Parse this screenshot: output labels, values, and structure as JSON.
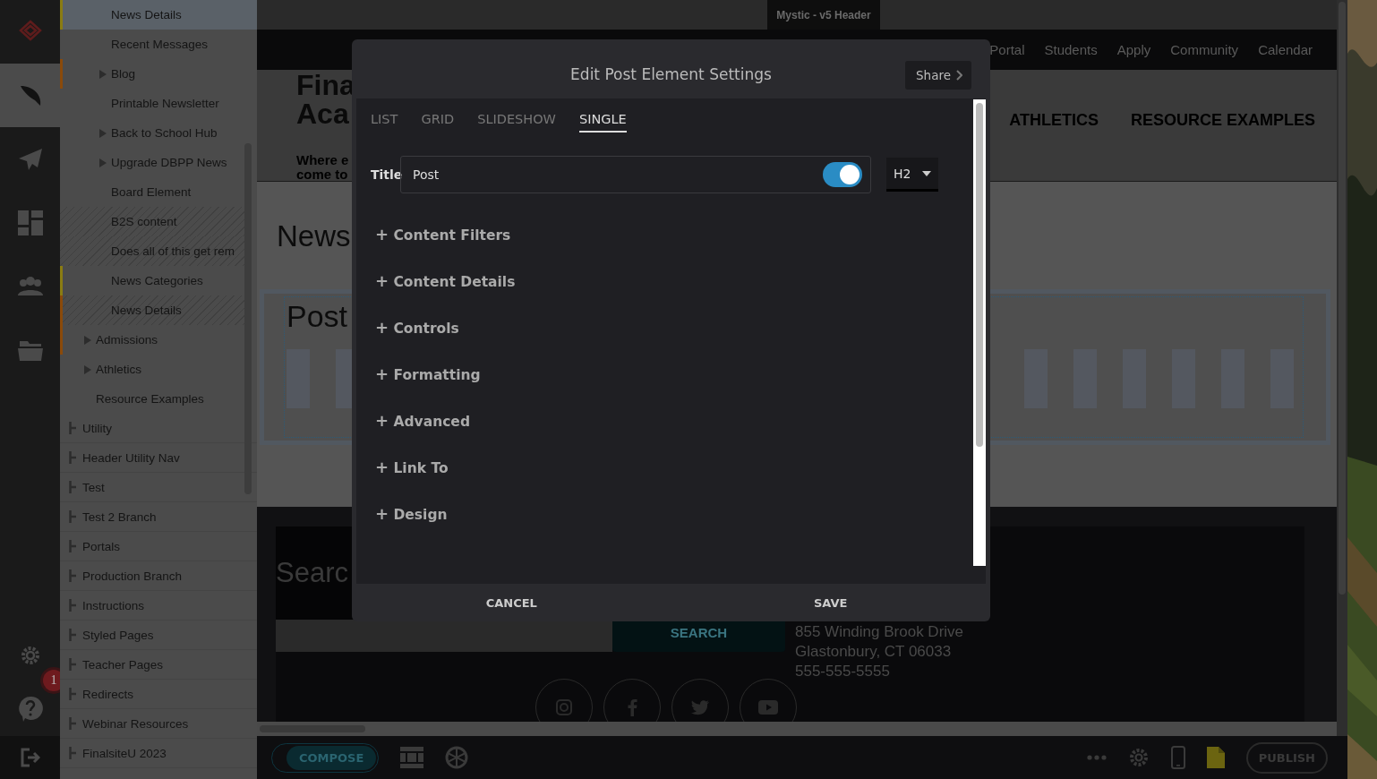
{
  "rail": {
    "items": [
      {
        "kind": "logo",
        "selected": false
      },
      {
        "kind": "feather",
        "selected": true
      },
      {
        "kind": "plane",
        "selected": false
      },
      {
        "kind": "dashboard",
        "selected": false
      },
      {
        "kind": "people",
        "selected": false
      },
      {
        "kind": "folder",
        "selected": false
      }
    ],
    "badge": "1"
  },
  "sidebar": {
    "tree": [
      {
        "children": [
          {
            "children": [
              {
                "label": "News Details",
                "kind": "leaf",
                "selected": true,
                "hidden": false,
                "color": "#8a7c12"
              },
              {
                "label": "Recent Messages",
                "kind": "leaf",
                "selected": false,
                "hidden": false
              },
              {
                "label": "Blog",
                "kind": "folder",
                "selected": false,
                "hidden": false,
                "color": "#8a4a0a"
              },
              {
                "label": "Printable Newsletter",
                "kind": "leaf",
                "selected": false,
                "hidden": false
              },
              {
                "label": "Back to School Hub",
                "kind": "folder",
                "selected": false,
                "hidden": false
              },
              {
                "label": "Upgrade DBPP News",
                "kind": "folder",
                "selected": false,
                "hidden": false
              },
              {
                "label": "Board Element",
                "kind": "leaf",
                "selected": false,
                "hidden": false
              },
              {
                "label": "B2S content",
                "kind": "leaf",
                "selected": false,
                "hidden": true
              },
              {
                "label": "Does all of this get rem",
                "kind": "leaf",
                "selected": false,
                "hidden": true
              },
              {
                "label": "News Categories",
                "kind": "leaf",
                "selected": false,
                "hidden": false,
                "color": "#8a7c12"
              },
              {
                "label": "News Details",
                "kind": "leaf",
                "selected": false,
                "hidden": true,
                "color": "#8a4a0a"
              }
            ]
          },
          {
            "label": "Admissions",
            "kind": "folder",
            "selected": false,
            "hidden": false,
            "color": "#8a4a0a"
          },
          {
            "label": "Athletics",
            "kind": "folder",
            "selected": false,
            "hidden": false
          },
          {
            "label": "Resource Examples",
            "kind": "leaf",
            "selected": false,
            "hidden": false
          }
        ]
      },
      {
        "label": "Utility",
        "kind": "branch",
        "selected": false,
        "hidden": false
      },
      {
        "label": "Header Utility Nav",
        "kind": "branch",
        "selected": false,
        "hidden": false
      },
      {
        "label": "Test",
        "kind": "branch",
        "selected": false,
        "hidden": false
      },
      {
        "label": "Test 2 Branch",
        "kind": "branch",
        "selected": false,
        "hidden": false
      },
      {
        "label": "Portals",
        "kind": "branch",
        "selected": false,
        "hidden": false
      },
      {
        "label": "Production Branch",
        "kind": "branch",
        "selected": false,
        "hidden": false
      },
      {
        "label": "Instructions",
        "kind": "branch",
        "selected": false,
        "hidden": false
      },
      {
        "label": "Styled Pages",
        "kind": "branch",
        "selected": false,
        "hidden": false
      },
      {
        "label": "Teacher Pages",
        "kind": "branch",
        "selected": false,
        "hidden": false
      },
      {
        "label": "Redirects",
        "kind": "branch",
        "selected": false,
        "hidden": false
      },
      {
        "label": "Webinar Resources",
        "kind": "branch",
        "selected": false,
        "hidden": false
      },
      {
        "label": "FinalsiteU 2023",
        "kind": "branch",
        "selected": false,
        "hidden": false
      }
    ]
  },
  "page": {
    "header_tab": "Mystic - v5 Header",
    "utility_nav": [
      "Portal",
      "Students",
      "Apply",
      "Community",
      "Calendar"
    ],
    "brand": [
      "Fina",
      "Aca"
    ],
    "tagline": [
      "Where e",
      "come to"
    ],
    "main_nav": [
      "ATHLETICS",
      "RESOURCE EXAMPLES"
    ],
    "heading": "News",
    "post_title": "Post",
    "footer": {
      "search_heading": "Searc",
      "search_button": "SEARCH",
      "address": [
        "855 Winding Brook Drive",
        "Glastonbury, CT 06033",
        "555-555-5555"
      ],
      "social": [
        {
          "kind": "camera"
        },
        {
          "kind": "letter-f"
        },
        {
          "kind": "bird"
        },
        {
          "kind": "play"
        }
      ]
    }
  },
  "toolbar": {
    "compose": "COMPOSE",
    "compose_on": true,
    "publish": "PUBLISH"
  },
  "modal": {
    "title": "Edit Post Element Settings",
    "share": "Share",
    "tabs": [
      {
        "label": "LIST",
        "selected": false
      },
      {
        "label": "GRID",
        "selected": false
      },
      {
        "label": "SLIDESHOW",
        "selected": false
      },
      {
        "label": "SINGLE",
        "selected": true
      }
    ],
    "title_field": {
      "label": "Title",
      "value": "Post",
      "on": true,
      "heading": "H2"
    },
    "sections": [
      "Content Filters",
      "Content Details",
      "Controls",
      "Formatting",
      "Advanced",
      "Link To",
      "Design"
    ],
    "plus": "+",
    "buttons": [
      "CANCEL",
      "SAVE"
    ]
  }
}
